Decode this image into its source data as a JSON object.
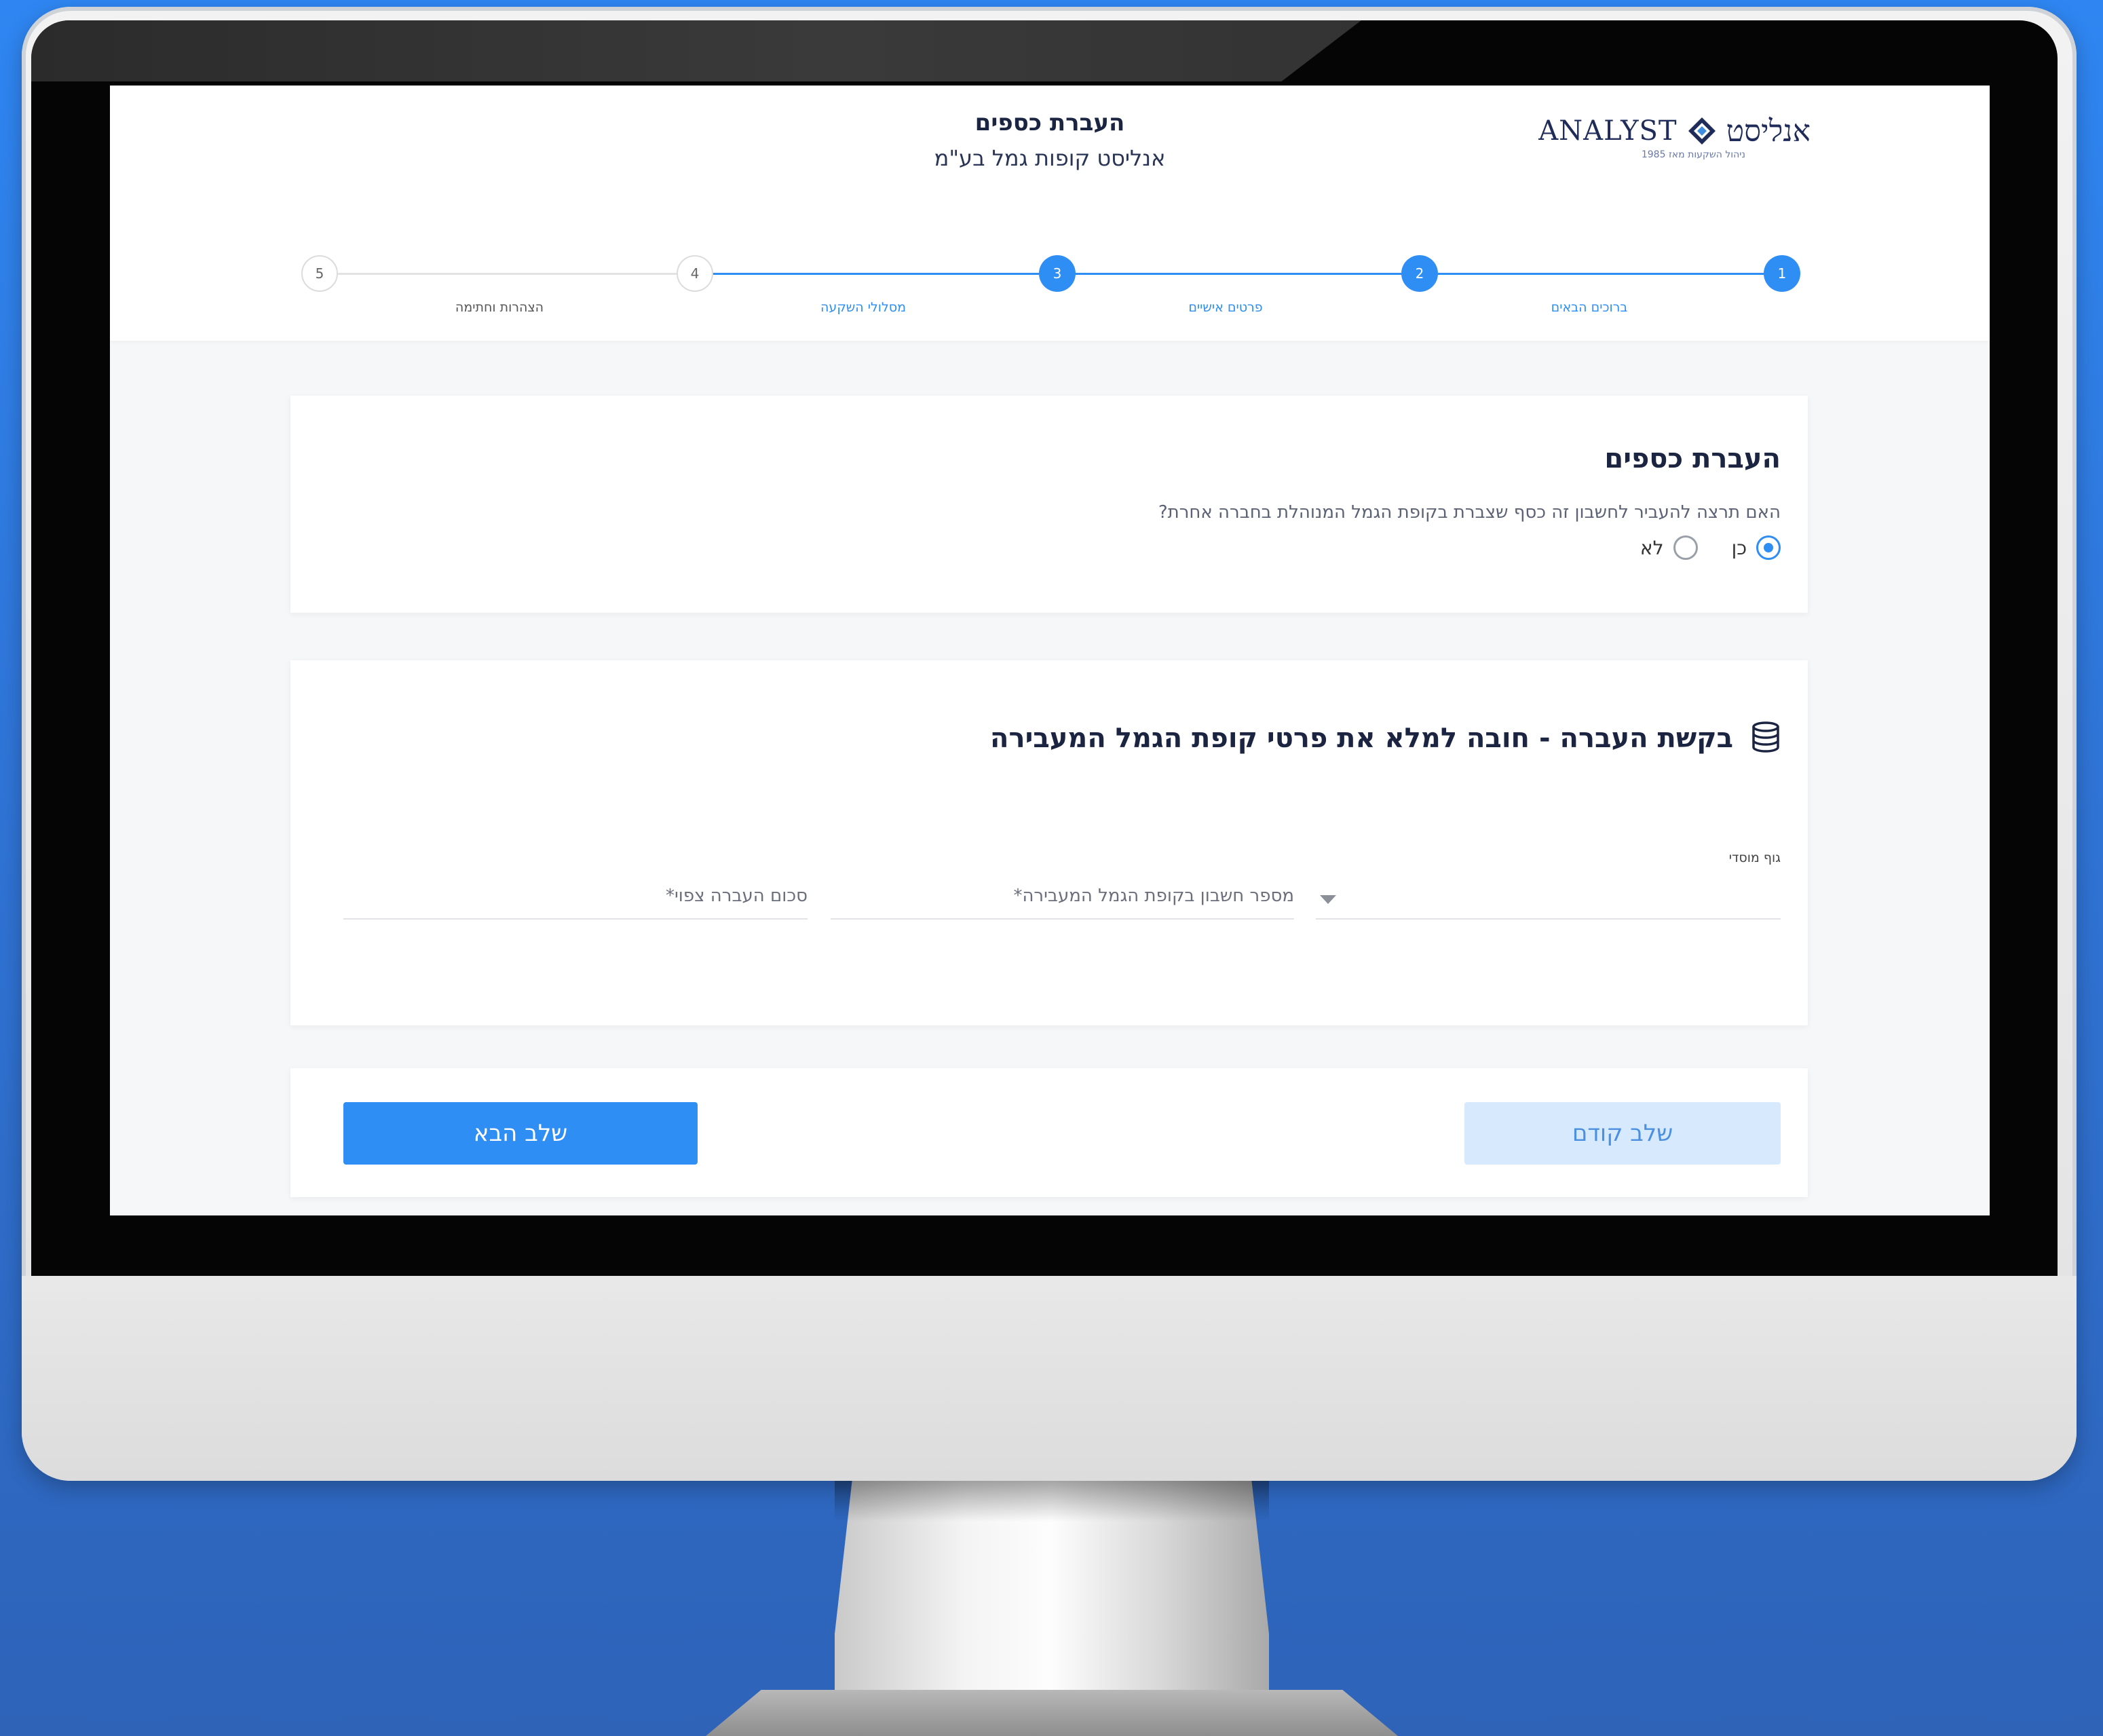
{
  "app": {
    "logo_en": "ANALYST",
    "logo_he": "אנליסט",
    "logo_tagline": "ניהול השקעות מאז 1985",
    "title": "העברת כספים",
    "subtitle": "אנליסט קופות גמל בע\"מ"
  },
  "stepper": {
    "steps": [
      {
        "number": "1",
        "label": "ברוכים הבאים",
        "state": "done"
      },
      {
        "number": "2",
        "label": "פרטים אישיים",
        "state": "done"
      },
      {
        "number": "3",
        "label": "מסלולי השקעה",
        "state": "done"
      },
      {
        "number": "4",
        "label": "",
        "state": "todo"
      },
      {
        "number": "5",
        "label": "הצהרות וחתימה",
        "state": "todo"
      }
    ]
  },
  "transfer_question": {
    "title": "העברת כספים",
    "question": "האם תרצה להעביר לחשבון זה כסף שצברת בקופת הגמל המנוהלת בחברה אחרת?",
    "options": [
      {
        "label": "כן",
        "selected": true
      },
      {
        "label": "לא",
        "selected": false
      }
    ]
  },
  "transfer_request": {
    "title": "בקשת העברה - חובה למלא את פרטי קופת הגמל המעבירה",
    "icon": "coins-stack-icon",
    "fields": {
      "institution_label": "גוף מוסדי",
      "account_placeholder": "מספר חשבון בקופת הגמל המעבירה*",
      "amount_placeholder": "סכום העברה צפוי*"
    }
  },
  "navigation": {
    "prev_label": "שלב קודם",
    "next_label": "שלב הבא"
  },
  "colors": {
    "accent": "#2e8ef3",
    "accent_light": "#d6e9fd",
    "heading": "#1b2440"
  }
}
